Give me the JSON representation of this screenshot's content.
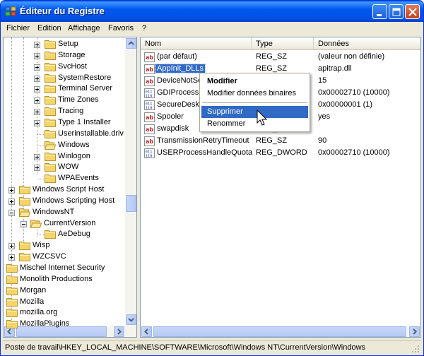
{
  "window": {
    "title": "Éditeur du Registre"
  },
  "menu": [
    "Fichier",
    "Edition",
    "Affichage",
    "Favoris",
    "?"
  ],
  "tree": [
    {
      "label": "Setup",
      "expander": "plus"
    },
    {
      "label": "Storage",
      "expander": "plus"
    },
    {
      "label": "SvcHost",
      "expander": "plus"
    },
    {
      "label": "SystemRestore",
      "expander": "plus"
    },
    {
      "label": "Terminal Server",
      "expander": "plus"
    },
    {
      "label": "Time Zones",
      "expander": "plus"
    },
    {
      "label": "Tracing",
      "expander": "plus"
    },
    {
      "label": "Type 1 Installer",
      "expander": "plus"
    },
    {
      "label": "Userinstallable.driv",
      "expander": "none"
    },
    {
      "label": "Windows",
      "expander": "none",
      "selected": true
    },
    {
      "label": "Winlogon",
      "expander": "plus"
    },
    {
      "label": "WOW",
      "expander": "plus"
    },
    {
      "label": "WPAEvents",
      "expander": "none"
    },
    {
      "label": "Windows Script Host",
      "expander": "plus"
    },
    {
      "label": "Windows Scripting Host",
      "expander": "plus"
    },
    {
      "label": "WindowsNT",
      "expander": "minus"
    },
    {
      "label": "CurrentVersion",
      "expander": "minus"
    },
    {
      "label": "AeDebug",
      "expander": "none"
    },
    {
      "label": "Wisp",
      "expander": "plus"
    },
    {
      "label": "WZCSVC",
      "expander": "plus"
    },
    {
      "label": "Mischel Internet Security",
      "expander": "none"
    },
    {
      "label": "Monolith Productions",
      "expander": "none"
    },
    {
      "label": "Morgan",
      "expander": "none"
    },
    {
      "label": "Mozilla",
      "expander": "none"
    },
    {
      "label": "mozilla.org",
      "expander": "none"
    },
    {
      "label": "MozillaPlugins",
      "expander": "none"
    }
  ],
  "columns": {
    "name": "Nom",
    "type": "Type",
    "data": "Données"
  },
  "values": [
    {
      "name": "(par défaut)",
      "type": "REG_SZ",
      "data": "(valeur non définie)",
      "kind": "string"
    },
    {
      "name": "AppInit_DLLs",
      "type": "REG_SZ",
      "data": "apitrap.dll",
      "kind": "string",
      "selected": true
    },
    {
      "name": "DeviceNotSelectionTimeout",
      "type": "REG_SZ",
      "data": "15",
      "kind": "string"
    },
    {
      "name": "GDIProcessHandleQuota",
      "type": "REG_DWORD",
      "data": "0x00002710 (10000)",
      "kind": "binary"
    },
    {
      "name": "SecureDesktop",
      "type": "REG_DWORD",
      "data": "0x00000001 (1)",
      "kind": "binary"
    },
    {
      "name": "Spooler",
      "type": "REG_SZ",
      "data": "yes",
      "kind": "string"
    },
    {
      "name": "swapdisk",
      "type": "REG_SZ",
      "data": "",
      "kind": "string"
    },
    {
      "name": "TransmissionRetryTimeout",
      "type": "REG_SZ",
      "data": "90",
      "kind": "string"
    },
    {
      "name": "USERProcessHandleQuota",
      "type": "REG_DWORD",
      "data": "0x00002710 (10000)",
      "kind": "binary"
    }
  ],
  "context_menu": {
    "modify": "Modifier",
    "modify_binary": "Modifier données binaires",
    "delete": "Supprimer",
    "rename": "Renommer"
  },
  "status": {
    "path": "Poste de travail\\HKEY_LOCAL_MACHINE\\SOFTWARE\\Microsoft\\Windows NT\\CurrentVersion\\Windows"
  },
  "icons": {
    "app": "regedit-icon",
    "folder": "folder-icon",
    "string_value": "string-value-icon",
    "binary_value": "binary-value-icon",
    "cursor": "mouse-pointer-icon"
  },
  "colors": {
    "title_bar": "#0058ee",
    "selection": "#316ac5",
    "face": "#ece9d8"
  }
}
